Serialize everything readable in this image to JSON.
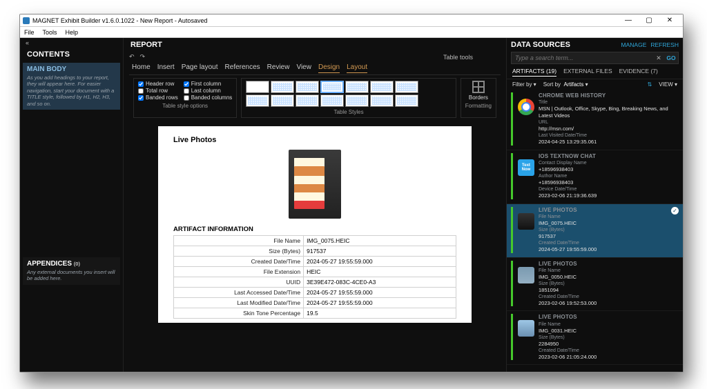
{
  "title": "MAGNET Exhibit Builder v1.6.0.1022 - New Report - Autosaved",
  "menu": {
    "file": "File",
    "tools": "Tools",
    "help": "Help"
  },
  "left": {
    "title": "CONTENTS",
    "main": {
      "title": "MAIN BODY",
      "hint": "As you add headings to your report, they will appear here. For easier navigation, start your document with a TITLE style, followed by H1, H2, H3, and so on."
    },
    "appendices": {
      "title": "APPENDICES",
      "count": "(0)",
      "hint": "Any external documents you insert will be added here."
    }
  },
  "mid": {
    "title": "REPORT",
    "tabletools": "Table tools",
    "tabs": {
      "home": "Home",
      "insert": "Insert",
      "pagelayout": "Page layout",
      "references": "References",
      "review": "Review",
      "view": "View",
      "design": "Design",
      "layout": "Layout"
    },
    "checks": {
      "headerrow": "Header row",
      "totalrow": "Total row",
      "bandedrows": "Banded rows",
      "firstcol": "First column",
      "lastcol": "Last column",
      "bandedcols": "Banded columns"
    },
    "groups": {
      "options": "Table style options",
      "styles": "Table Styles",
      "formatting": "Formatting",
      "borders": "Borders"
    },
    "doc": {
      "heading": "Live Photos",
      "section": "ARTIFACT INFORMATION",
      "rows": [
        {
          "k": "File Name",
          "v": "IMG_0075.HEIC"
        },
        {
          "k": "Size (Bytes)",
          "v": "917537"
        },
        {
          "k": "Created Date/Time",
          "v": "2024-05-27 19:55:59.000"
        },
        {
          "k": "File Extension",
          "v": "HEIC"
        },
        {
          "k": "UUID",
          "v": "3E39E472-083C-4CE0-A3"
        },
        {
          "k": "Last Accessed Date/Time",
          "v": "2024-05-27 19:55:59.000"
        },
        {
          "k": "Last Modified Date/Time",
          "v": "2024-05-27 19:55:59.000"
        },
        {
          "k": "Skin Tone Percentage",
          "v": "19.5"
        }
      ]
    }
  },
  "right": {
    "title": "DATA SOURCES",
    "manage": "MANAGE",
    "refresh": "REFRESH",
    "searchPlaceholder": "Type a search term...",
    "go": "GO",
    "tabs": {
      "artifacts": "ARTIFACTS (19)",
      "external": "EXTERNAL FILES",
      "evidence": "EVIDENCE (7)"
    },
    "filter": "Filter by",
    "sort": "Sort by",
    "sortval": "Artifacts",
    "view": "VIEW",
    "cards": [
      {
        "cat": "CHROME WEB HISTORY",
        "f1": "Title",
        "v1": "MSN | Outlook, Office, Skype, Bing, Breaking News, and Latest Videos",
        "f2": "URL",
        "v2": "http://msn.com/",
        "f3": "Last Visited Date/Time",
        "v3": "2024-04-25 13:29:35.061",
        "thumb": "chrome"
      },
      {
        "cat": "IOS TEXTNOW CHAT",
        "f1": "Contact Display Name",
        "v1": "+18596938403",
        "f2": "Author Name",
        "v2": "+18596938403",
        "f3": "Device Date/Time",
        "v3": "2023-02-06 21:19:36.639",
        "thumb": "textnow"
      },
      {
        "cat": "LIVE PHOTOS",
        "f1": "File Name",
        "v1": "IMG_0075.HEIC",
        "f2": "Size (Bytes)",
        "v2": "917537",
        "f3": "Created Date/Time",
        "v3": "2024-05-27 19:55:59.000",
        "thumb": "photo1",
        "sel": true
      },
      {
        "cat": "LIVE PHOTOS",
        "f1": "File Name",
        "v1": "IMG_0050.HEIC",
        "f2": "Size (Bytes)",
        "v2": "1851094",
        "f3": "Created Date/Time",
        "v3": "2023-02-06 19:52:53.000",
        "thumb": "photo2"
      },
      {
        "cat": "LIVE PHOTOS",
        "f1": "File Name",
        "v1": "IMG_0031.HEIC",
        "f2": "Size (Bytes)",
        "v2": "2284950",
        "f3": "Created Date/Time",
        "v3": "2023-02-06 21:05:24.000",
        "thumb": "photo3"
      }
    ]
  }
}
